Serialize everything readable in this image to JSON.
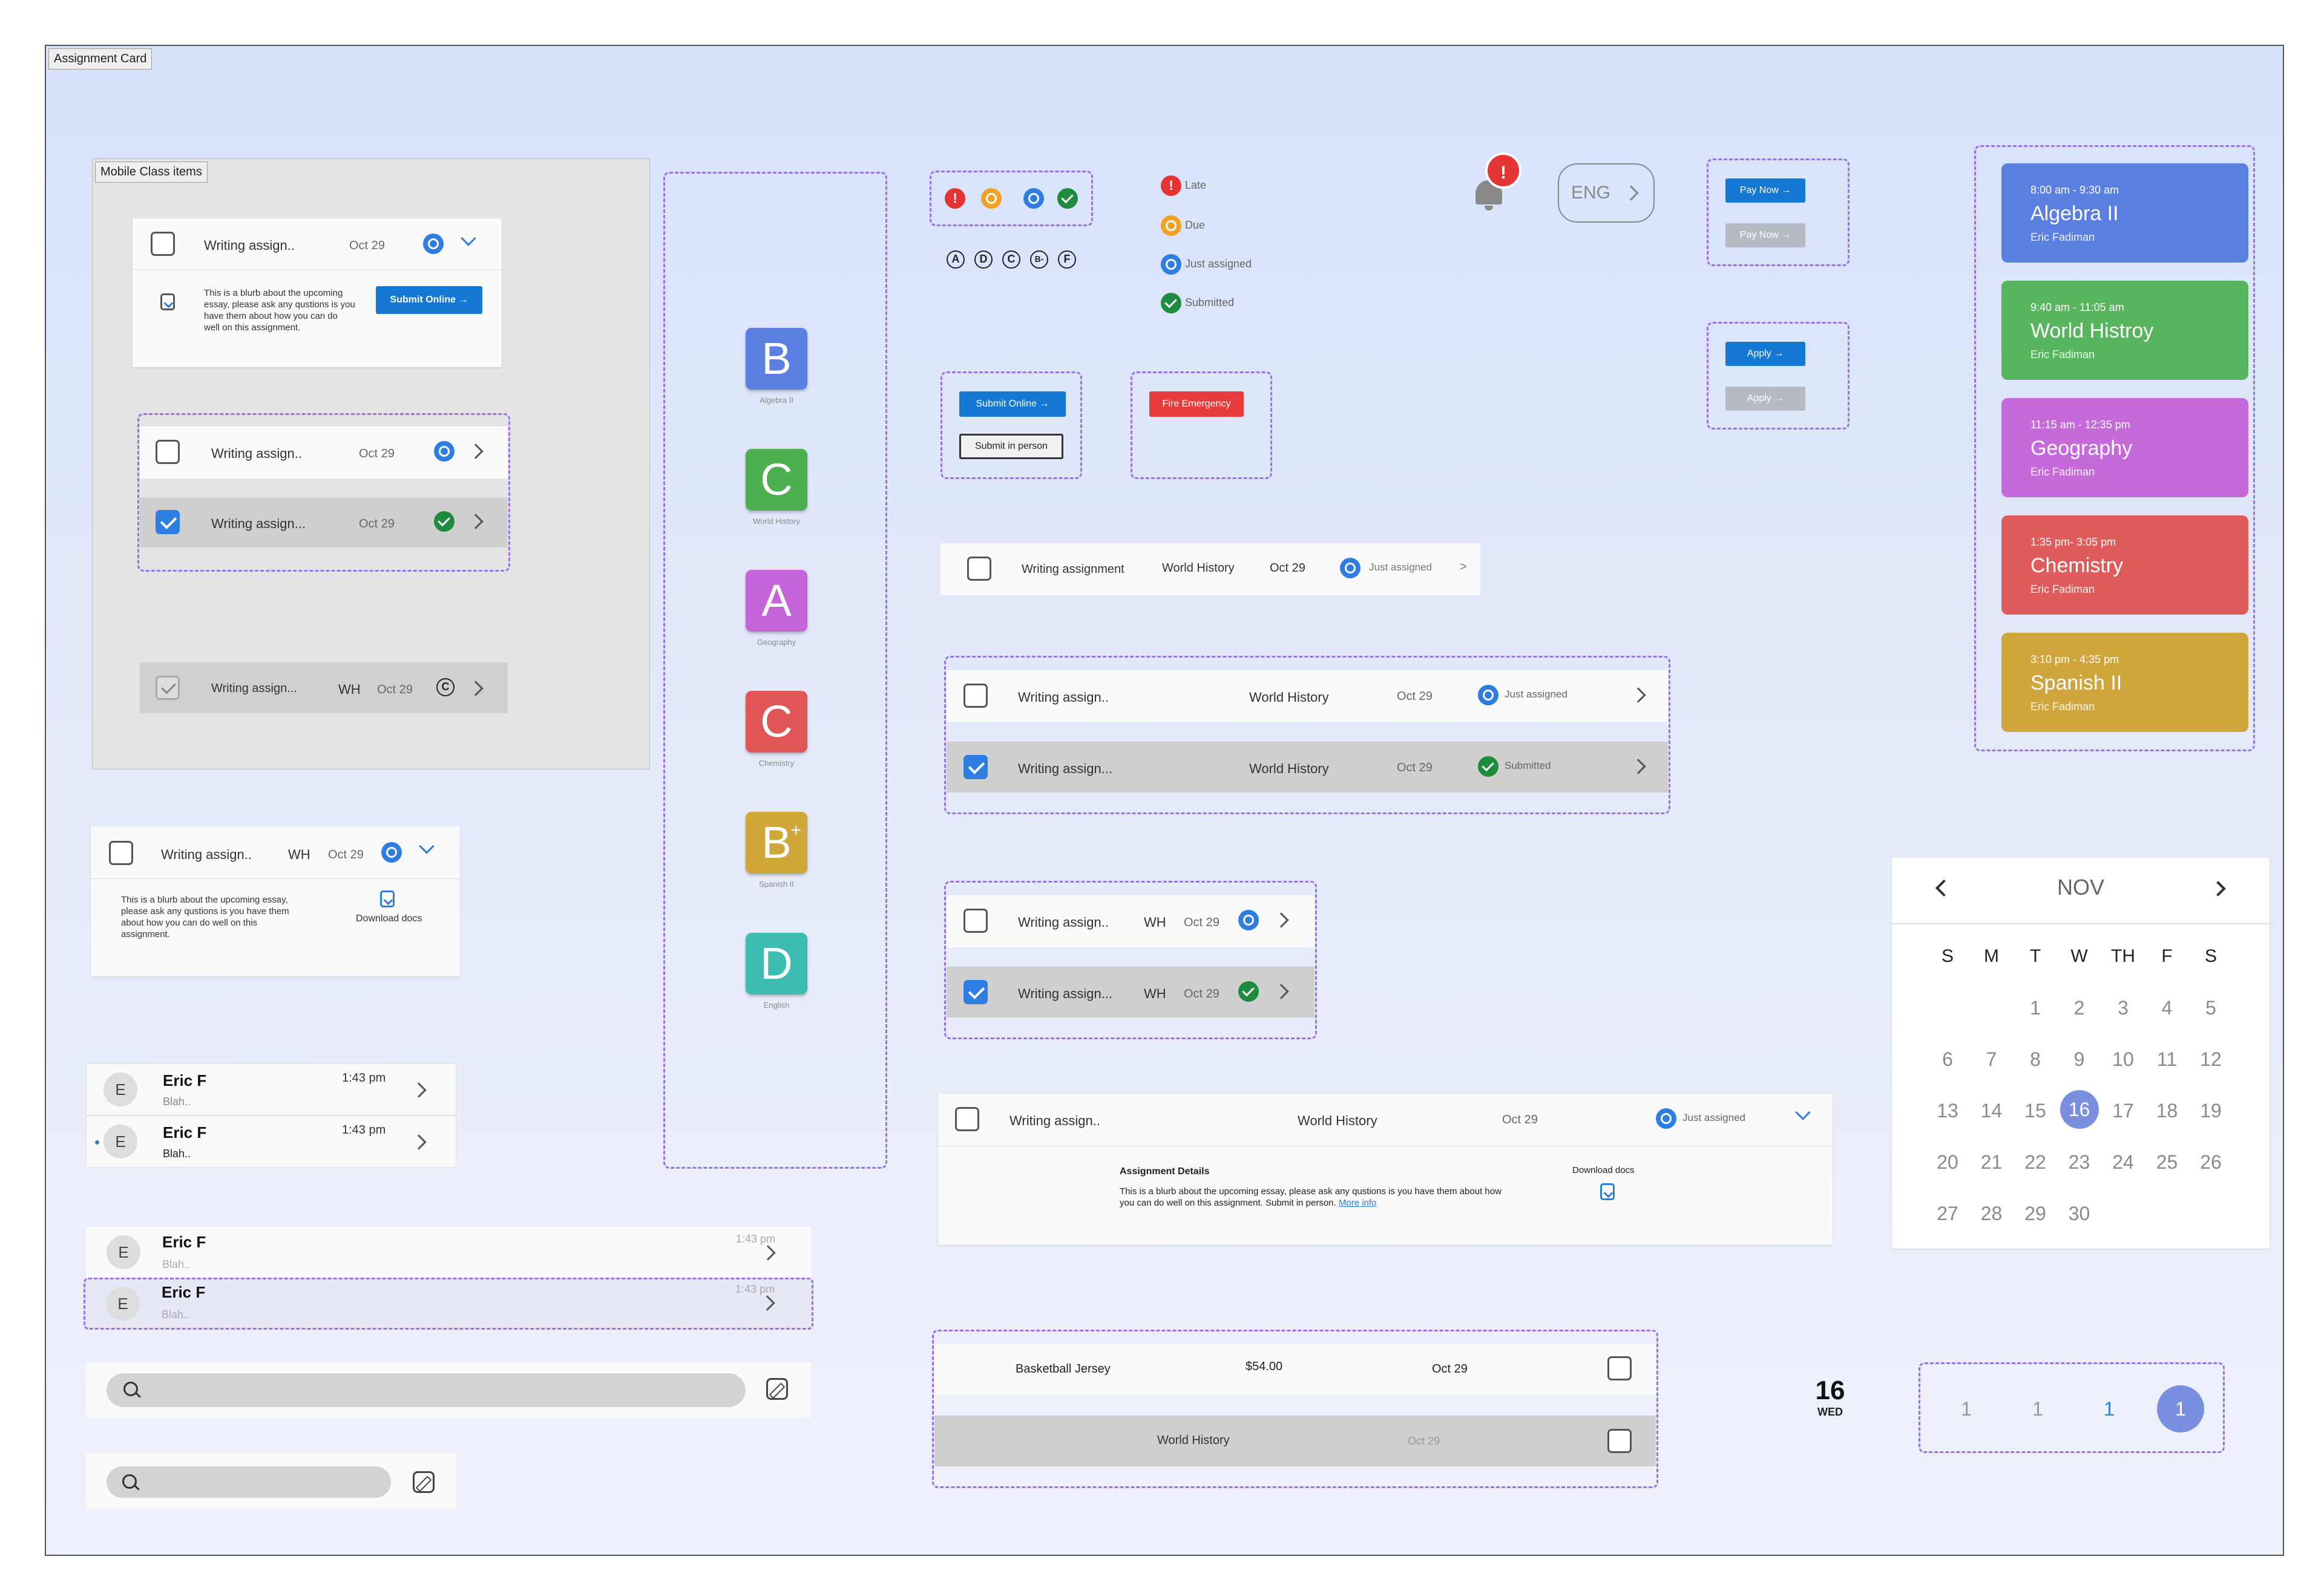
{
  "frame_tag": "Assignment Card",
  "mobile_tag": "Mobile Class items",
  "assignment": {
    "short_title": "Writing assign..",
    "short_title_alt": "Writing assign...",
    "full_title": "Writing assignment",
    "date": "Oct 29",
    "wh": "WH",
    "class": "World History",
    "blurb": "This is a blurb about the upcoming essay, please ask any qustions is you have them about how you can do well on this assignment.",
    "blurb_long": "This is a blurb about the upcoming essay, please ask any qustions is you have them about how you can do well on this assignment. Submit in person.",
    "more_info": "More info",
    "details_heading": "Assignment Details",
    "download": "Download docs",
    "status_just": "Just assigned",
    "status_submitted": "Submitted",
    "chevron": ">"
  },
  "buttons": {
    "submit_online": "Submit Online →",
    "submit_in_person": "Submit in person",
    "fire_emergency": "Fire Emergency",
    "pay_now": "Pay Now →",
    "apply": "Apply →"
  },
  "legend": {
    "late": "Late",
    "due": "Due",
    "just_assigned": "Just assigned",
    "submitted": "Submitted"
  },
  "grades_circles": [
    "A",
    "D",
    "C",
    "B-",
    "F"
  ],
  "grades": [
    {
      "letter": "B",
      "label": "Algebra II",
      "color": "#5b7fe0"
    },
    {
      "letter": "C",
      "label": "World History",
      "color": "#4caf50"
    },
    {
      "letter": "A",
      "label": "Geography",
      "color": "#c464d8"
    },
    {
      "letter": "C",
      "label": "Chemistry",
      "color": "#e05555"
    },
    {
      "letter": "B",
      "sup": "+",
      "label": "Spanish II",
      "color": "#d1a73a"
    },
    {
      "letter": "D",
      "label": "English",
      "color": "#3dbdb2"
    }
  ],
  "notification": {
    "badge": "!"
  },
  "language": {
    "label": "ENG"
  },
  "schedule": [
    {
      "time": "8:00 am - 9:30 am",
      "name": "Algebra II",
      "teacher": "Eric Fadiman",
      "color": "#5b7fe0"
    },
    {
      "time": "9:40 am - 11:05 am",
      "name": "World Histroy",
      "teacher": "Eric Fadiman",
      "color": "#57b55d"
    },
    {
      "time": "11:15 am - 12:35 pm",
      "name": "Geography",
      "teacher": "Eric Fadiman",
      "color": "#c76ad9"
    },
    {
      "time": "1:35 pm- 3:05 pm",
      "name": "Chemistry",
      "teacher": "Eric Fadiman",
      "color": "#e05c5c"
    },
    {
      "time": "3:10 pm - 4:35 pm",
      "name": "Spanish II",
      "teacher": "Eric Fadiman",
      "color": "#cfa53c"
    }
  ],
  "calendar": {
    "month": "NOV",
    "weekdays": [
      "S",
      "M",
      "T",
      "W",
      "TH",
      "F",
      "S"
    ],
    "weeks": [
      [
        "",
        "",
        "1",
        "2",
        "3",
        "4",
        "5"
      ],
      [
        "6",
        "7",
        "8",
        "9",
        "10",
        "11",
        "12"
      ],
      [
        "13",
        "14",
        "15",
        "16",
        "17",
        "18",
        "19"
      ],
      [
        "20",
        "21",
        "22",
        "23",
        "24",
        "25",
        "26"
      ],
      [
        "27",
        "28",
        "29",
        "30",
        "",
        "",
        ""
      ]
    ],
    "selected": "16"
  },
  "messages": {
    "name": "Eric F",
    "time": "1:43 pm",
    "preview": "Blah..",
    "avatar": "E"
  },
  "store": {
    "item": "Basketball Jersey",
    "price": "$54.00",
    "date": "Oct 29",
    "class": "World History"
  },
  "date_badge": {
    "day": "16",
    "weekday": "WED"
  },
  "pagination": [
    "1",
    "1",
    "1",
    "1"
  ]
}
